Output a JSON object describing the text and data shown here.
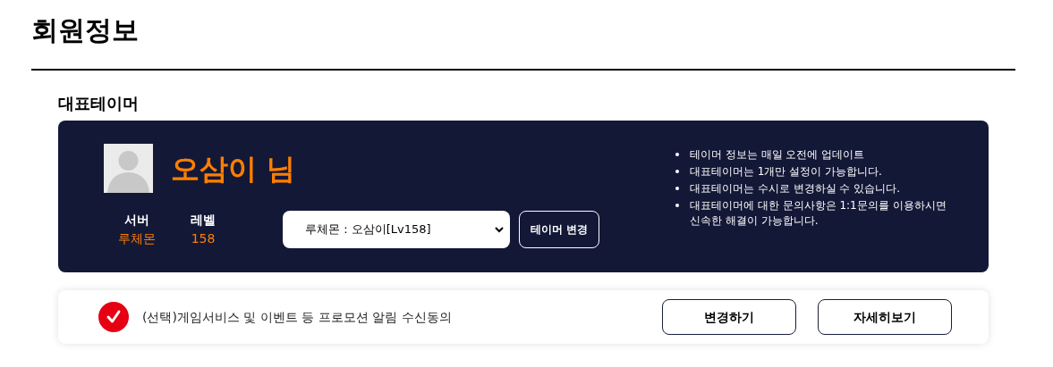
{
  "page_title": "회원정보",
  "section_title": "대표테이머",
  "tamer": {
    "name": "오삼이 님",
    "stats": [
      {
        "label": "서버",
        "value": "루체몬"
      },
      {
        "label": "레벨",
        "value": "158"
      }
    ],
    "select": {
      "value": "루체몬 : 오삼이[Lv158]"
    },
    "change_button": "테이머 변경"
  },
  "notes": [
    "테이머 정보는 매일 오전에 업데이트",
    "대표테이머는 1개만 설정이 가능합니다.",
    "대표테이머는 수시로 변경하실 수 있습니다.",
    "대표테이머에 대한 문의사항은 1:1문의를 이용하시면 신속한 해결이 가능합니다."
  ],
  "consent": {
    "checked": true,
    "label": "(선택)게임서비스 및 이벤트 등 프로모션 알림 수신동의",
    "buttons": [
      "변경하기",
      "자세히보기"
    ]
  }
}
